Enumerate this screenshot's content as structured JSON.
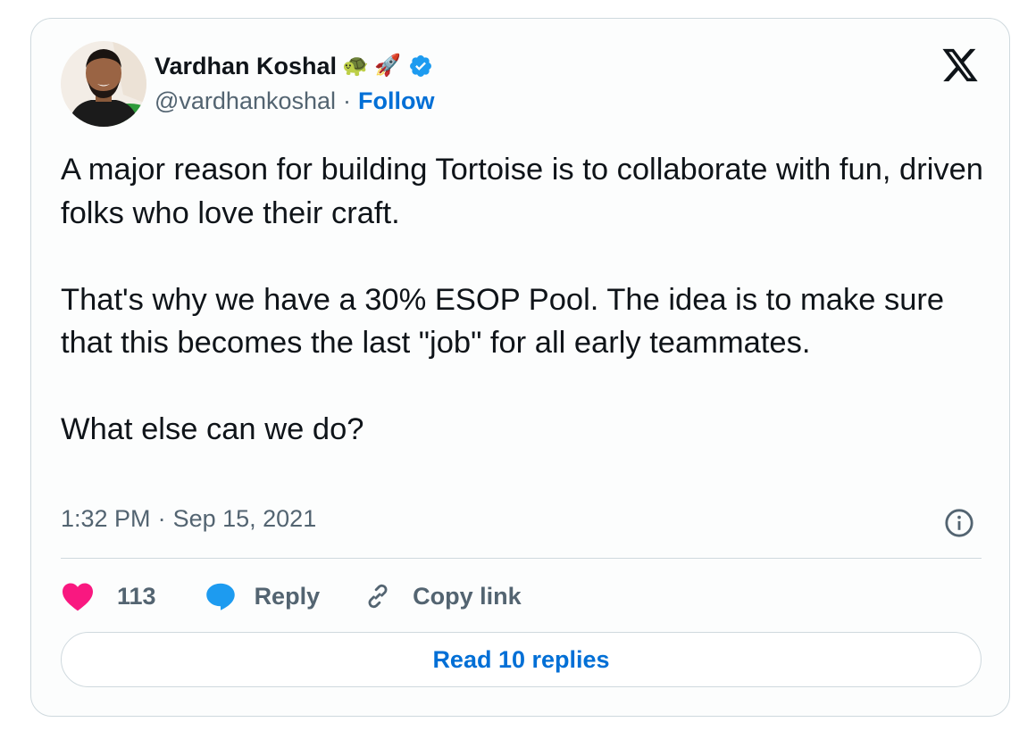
{
  "author": {
    "display_name": "Vardhan Koshal",
    "emoji_1": "🐢",
    "emoji_2": "🚀",
    "handle": "@vardhankoshal",
    "separator": "·",
    "follow_label": "Follow"
  },
  "tweet": {
    "text": "A major reason for building Tortoise is to collaborate with fun, driven folks who love their craft.\n\nThat's why we have a 30% ESOP Pool. The idea is to make sure that this becomes the last \"job\" for all early teammates.\n\nWhat else can we do?",
    "time": "1:32 PM",
    "separator": "·",
    "date": "Sep 15, 2021"
  },
  "actions": {
    "like_count": "113",
    "reply_label": "Reply",
    "copy_link_label": "Copy link"
  },
  "footer": {
    "read_replies_label": "Read 10 replies"
  },
  "icons": [
    "verified-badge-icon",
    "x-logo-icon",
    "info-icon",
    "heart-icon",
    "reply-bubble-icon",
    "link-icon"
  ],
  "colors": {
    "accent_blue": "#006fd6",
    "verified_blue": "#1d9bf0",
    "heart_pink": "#f91880",
    "secondary_text": "#536471",
    "border": "#cfd9de"
  }
}
